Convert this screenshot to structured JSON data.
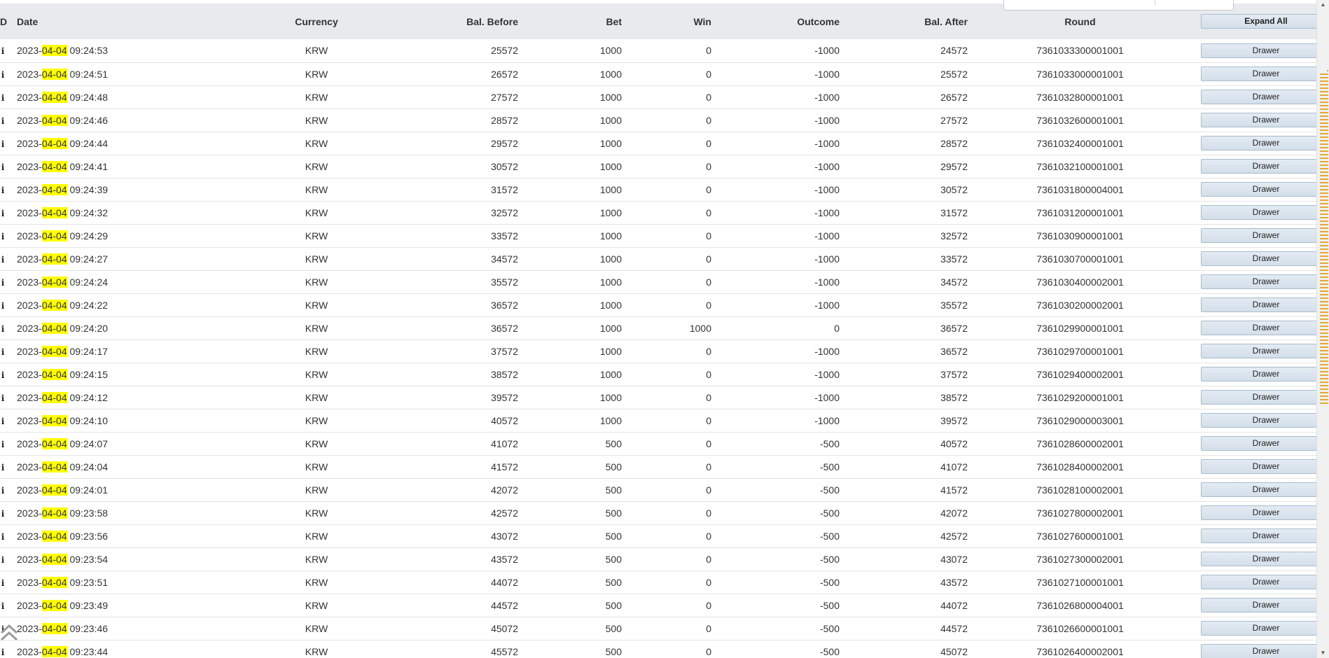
{
  "table": {
    "headers": {
      "id": "D",
      "date": "Date",
      "currency": "Currency",
      "bal_before": "Bal. Before",
      "bet": "Bet",
      "win": "Win",
      "outcome": "Outcome",
      "bal_after": "Bal. After",
      "round": "Round"
    },
    "expand_all_label": "Expand All",
    "action_label": "Drawer",
    "info_icon_glyph": "i",
    "highlight_color": "#ffff00",
    "rows": [
      {
        "date_year": "2023-",
        "date_md": "04-04",
        "date_time": " 09:24:53",
        "currency": "KRW",
        "bal_before": "25572",
        "bet": "1000",
        "win": "0",
        "outcome": "-1000",
        "bal_after": "24572",
        "round": "7361033300001001"
      },
      {
        "date_year": "2023-",
        "date_md": "04-04",
        "date_time": " 09:24:51",
        "currency": "KRW",
        "bal_before": "26572",
        "bet": "1000",
        "win": "0",
        "outcome": "-1000",
        "bal_after": "25572",
        "round": "7361033000001001"
      },
      {
        "date_year": "2023-",
        "date_md": "04-04",
        "date_time": " 09:24:48",
        "currency": "KRW",
        "bal_before": "27572",
        "bet": "1000",
        "win": "0",
        "outcome": "-1000",
        "bal_after": "26572",
        "round": "7361032800001001"
      },
      {
        "date_year": "2023-",
        "date_md": "04-04",
        "date_time": " 09:24:46",
        "currency": "KRW",
        "bal_before": "28572",
        "bet": "1000",
        "win": "0",
        "outcome": "-1000",
        "bal_after": "27572",
        "round": "7361032600001001"
      },
      {
        "date_year": "2023-",
        "date_md": "04-04",
        "date_time": " 09:24:44",
        "currency": "KRW",
        "bal_before": "29572",
        "bet": "1000",
        "win": "0",
        "outcome": "-1000",
        "bal_after": "28572",
        "round": "7361032400001001"
      },
      {
        "date_year": "2023-",
        "date_md": "04-04",
        "date_time": " 09:24:41",
        "currency": "KRW",
        "bal_before": "30572",
        "bet": "1000",
        "win": "0",
        "outcome": "-1000",
        "bal_after": "29572",
        "round": "7361032100001001"
      },
      {
        "date_year": "2023-",
        "date_md": "04-04",
        "date_time": " 09:24:39",
        "currency": "KRW",
        "bal_before": "31572",
        "bet": "1000",
        "win": "0",
        "outcome": "-1000",
        "bal_after": "30572",
        "round": "7361031800004001"
      },
      {
        "date_year": "2023-",
        "date_md": "04-04",
        "date_time": " 09:24:32",
        "currency": "KRW",
        "bal_before": "32572",
        "bet": "1000",
        "win": "0",
        "outcome": "-1000",
        "bal_after": "31572",
        "round": "7361031200001001"
      },
      {
        "date_year": "2023-",
        "date_md": "04-04",
        "date_time": " 09:24:29",
        "currency": "KRW",
        "bal_before": "33572",
        "bet": "1000",
        "win": "0",
        "outcome": "-1000",
        "bal_after": "32572",
        "round": "7361030900001001"
      },
      {
        "date_year": "2023-",
        "date_md": "04-04",
        "date_time": " 09:24:27",
        "currency": "KRW",
        "bal_before": "34572",
        "bet": "1000",
        "win": "0",
        "outcome": "-1000",
        "bal_after": "33572",
        "round": "7361030700001001"
      },
      {
        "date_year": "2023-",
        "date_md": "04-04",
        "date_time": " 09:24:24",
        "currency": "KRW",
        "bal_before": "35572",
        "bet": "1000",
        "win": "0",
        "outcome": "-1000",
        "bal_after": "34572",
        "round": "7361030400002001"
      },
      {
        "date_year": "2023-",
        "date_md": "04-04",
        "date_time": " 09:24:22",
        "currency": "KRW",
        "bal_before": "36572",
        "bet": "1000",
        "win": "0",
        "outcome": "-1000",
        "bal_after": "35572",
        "round": "7361030200002001"
      },
      {
        "date_year": "2023-",
        "date_md": "04-04",
        "date_time": " 09:24:20",
        "currency": "KRW",
        "bal_before": "36572",
        "bet": "1000",
        "win": "1000",
        "outcome": "0",
        "bal_after": "36572",
        "round": "7361029900001001"
      },
      {
        "date_year": "2023-",
        "date_md": "04-04",
        "date_time": " 09:24:17",
        "currency": "KRW",
        "bal_before": "37572",
        "bet": "1000",
        "win": "0",
        "outcome": "-1000",
        "bal_after": "36572",
        "round": "7361029700001001"
      },
      {
        "date_year": "2023-",
        "date_md": "04-04",
        "date_time": " 09:24:15",
        "currency": "KRW",
        "bal_before": "38572",
        "bet": "1000",
        "win": "0",
        "outcome": "-1000",
        "bal_after": "37572",
        "round": "7361029400002001"
      },
      {
        "date_year": "2023-",
        "date_md": "04-04",
        "date_time": " 09:24:12",
        "currency": "KRW",
        "bal_before": "39572",
        "bet": "1000",
        "win": "0",
        "outcome": "-1000",
        "bal_after": "38572",
        "round": "7361029200001001"
      },
      {
        "date_year": "2023-",
        "date_md": "04-04",
        "date_time": " 09:24:10",
        "currency": "KRW",
        "bal_before": "40572",
        "bet": "1000",
        "win": "0",
        "outcome": "-1000",
        "bal_after": "39572",
        "round": "7361029000003001"
      },
      {
        "date_year": "2023-",
        "date_md": "04-04",
        "date_time": " 09:24:07",
        "currency": "KRW",
        "bal_before": "41072",
        "bet": "500",
        "win": "0",
        "outcome": "-500",
        "bal_after": "40572",
        "round": "7361028600002001"
      },
      {
        "date_year": "2023-",
        "date_md": "04-04",
        "date_time": " 09:24:04",
        "currency": "KRW",
        "bal_before": "41572",
        "bet": "500",
        "win": "0",
        "outcome": "-500",
        "bal_after": "41072",
        "round": "7361028400002001"
      },
      {
        "date_year": "2023-",
        "date_md": "04-04",
        "date_time": " 09:24:01",
        "currency": "KRW",
        "bal_before": "42072",
        "bet": "500",
        "win": "0",
        "outcome": "-500",
        "bal_after": "41572",
        "round": "7361028100002001"
      },
      {
        "date_year": "2023-",
        "date_md": "04-04",
        "date_time": " 09:23:58",
        "currency": "KRW",
        "bal_before": "42572",
        "bet": "500",
        "win": "0",
        "outcome": "-500",
        "bal_after": "42072",
        "round": "7361027800002001"
      },
      {
        "date_year": "2023-",
        "date_md": "04-04",
        "date_time": " 09:23:56",
        "currency": "KRW",
        "bal_before": "43072",
        "bet": "500",
        "win": "0",
        "outcome": "-500",
        "bal_after": "42572",
        "round": "7361027600001001"
      },
      {
        "date_year": "2023-",
        "date_md": "04-04",
        "date_time": " 09:23:54",
        "currency": "KRW",
        "bal_before": "43572",
        "bet": "500",
        "win": "0",
        "outcome": "-500",
        "bal_after": "43072",
        "round": "7361027300002001"
      },
      {
        "date_year": "2023-",
        "date_md": "04-04",
        "date_time": " 09:23:51",
        "currency": "KRW",
        "bal_before": "44072",
        "bet": "500",
        "win": "0",
        "outcome": "-500",
        "bal_after": "43572",
        "round": "7361027100001001"
      },
      {
        "date_year": "2023-",
        "date_md": "04-04",
        "date_time": " 09:23:49",
        "currency": "KRW",
        "bal_before": "44572",
        "bet": "500",
        "win": "0",
        "outcome": "-500",
        "bal_after": "44072",
        "round": "7361026800004001"
      },
      {
        "date_year": "2023-",
        "date_md": "04-04",
        "date_time": " 09:23:46",
        "currency": "KRW",
        "bal_before": "45072",
        "bet": "500",
        "win": "0",
        "outcome": "-500",
        "bal_after": "44572",
        "round": "7361026600001001"
      },
      {
        "date_year": "2023-",
        "date_md": "04-04",
        "date_time": " 09:23:44",
        "currency": "KRW",
        "bal_before": "45572",
        "bet": "500",
        "win": "0",
        "outcome": "-500",
        "bal_after": "45072",
        "round": "7361026400002001"
      }
    ]
  },
  "scrollbar": {
    "up_arrow": "▲",
    "down_arrow": "▼",
    "marker_color": "#e5a935"
  },
  "icons": {
    "back_to_top": "double-chevron-up-icon"
  }
}
